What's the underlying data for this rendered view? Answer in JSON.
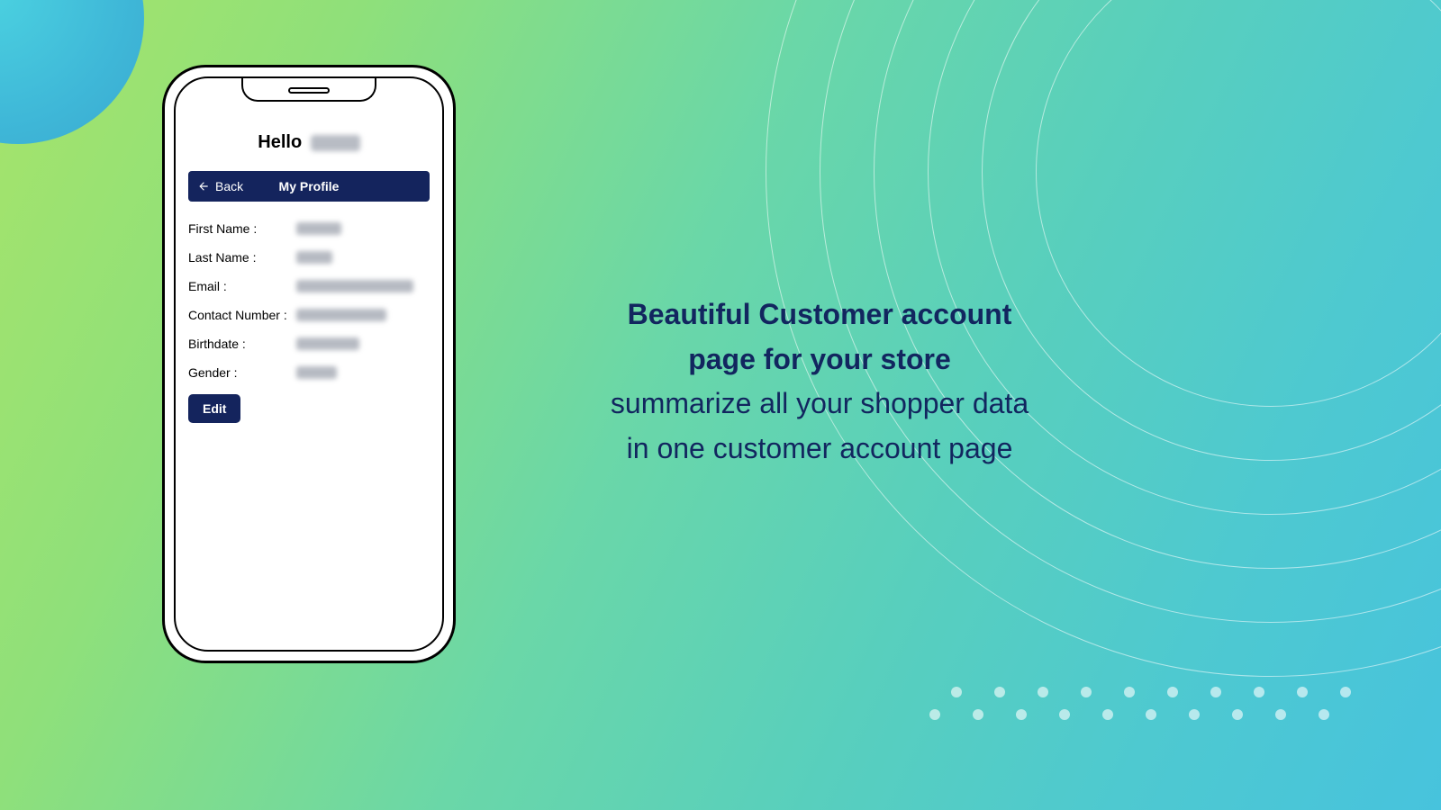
{
  "phone": {
    "greeting_prefix": "Hello",
    "titlebar": {
      "back_label": "Back",
      "title": "My Profile"
    },
    "fields": {
      "first_name_label": "First Name :",
      "last_name_label": "Last Name :",
      "email_label": "Email :",
      "contact_label": "Contact Number :",
      "birthdate_label": "Birthdate :",
      "gender_label": "Gender :"
    },
    "edit_label": "Edit"
  },
  "marketing": {
    "headline_line1": "Beautiful Customer account",
    "headline_line2": "page for your store",
    "sub_line1": "summarize all your shopper data",
    "sub_line2": "in one customer account page"
  },
  "colors": {
    "brand_navy": "#14245d"
  }
}
